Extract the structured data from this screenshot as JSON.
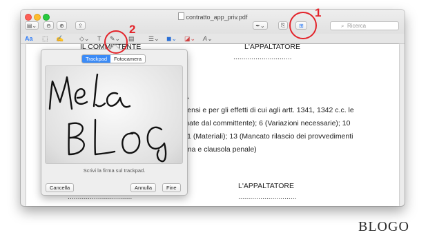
{
  "window": {
    "title": "contratto_app_priv.pdf"
  },
  "toolbar": {
    "sidebar": "▤⌄",
    "zoom_out": "⊖",
    "zoom_in": "⊕",
    "share": "⇪",
    "markup_pen": "✒⌄",
    "rotate": "⎘",
    "toolbox": "⊞",
    "search_placeholder": "Ricerca"
  },
  "markup": {
    "text_style": "Aa",
    "select": "⬚",
    "sketch": "✍",
    "shapes": "◇⌄",
    "text": "T",
    "sign": "✎⌄",
    "note": "▤",
    "line_style": "☰⌄",
    "border_color": "◼⌄",
    "fill_color": "◪⌄",
    "font": "A⌄"
  },
  "document": {
    "top_left": "IL COMMITTENTE",
    "top_right": "L'APPALTATORE",
    "dots_top_right": ".............................",
    "bold_letter": "A",
    "para": [
      "sensi e per gli effetti di cui agli artt. 1341, 1342 c.c. le",
      "inate dal committente); 6 (Variazioni necessarie); 10",
      "11 (Materiali); 13 (Mancato rilascio dei provvedimenti",
      "gna e clausola penale)"
    ],
    "bottom_right": "L'APPALTATORE",
    "dots_bottom_right": ".............................",
    "dots_bottom_left": "................................"
  },
  "signature_panel": {
    "tabs": [
      "Trackpad",
      "Fotocamera"
    ],
    "active_tab": "Trackpad",
    "hint": "Scrivi la firma sul trackpad.",
    "cancel": "Cancella",
    "clear": "Annulla",
    "done": "Fine",
    "handwriting": "Mela BLOG"
  },
  "annotations": {
    "n1": "1",
    "n2": "2"
  },
  "watermark": "BLOGO",
  "colors": {
    "accent": "#3c8bf6",
    "annotation": "#e3232a"
  }
}
